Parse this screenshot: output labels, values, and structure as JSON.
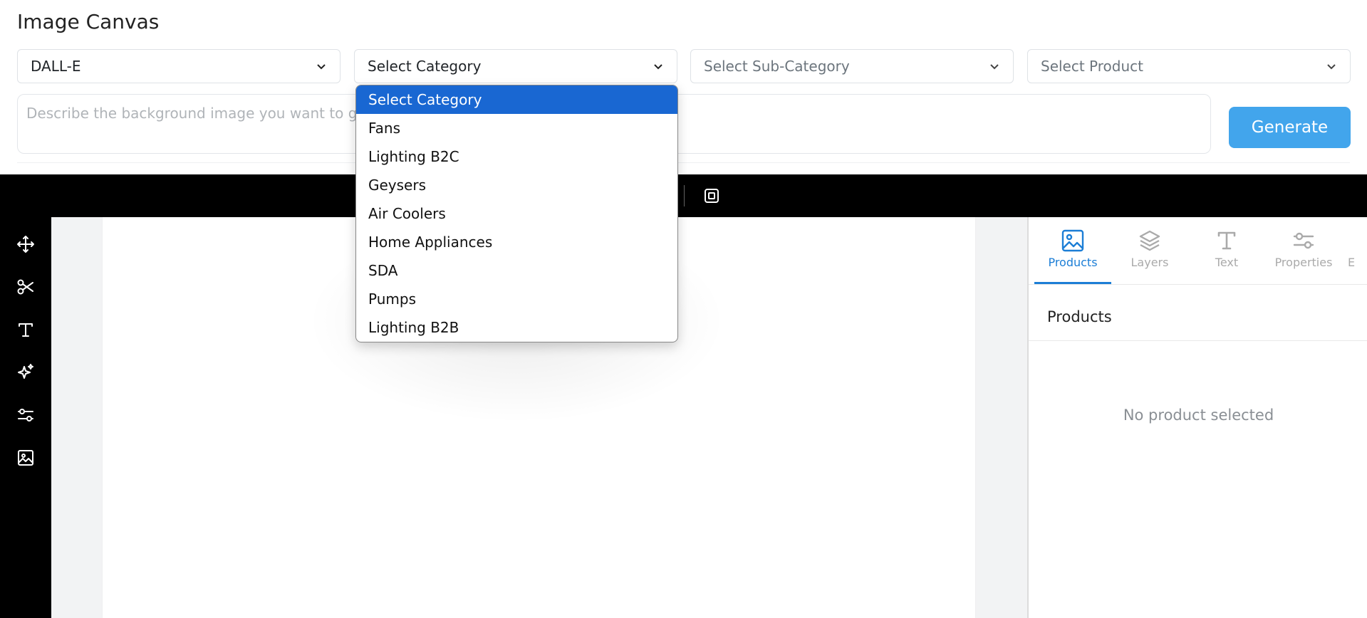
{
  "app": {
    "title": "Image Canvas"
  },
  "filters": {
    "model": "DALL-E",
    "category": "Select Category",
    "subcategory": "Select Sub-Category",
    "product": "Select Product"
  },
  "prompt": {
    "placeholder": "Describe the background image you want to gene"
  },
  "generate": {
    "label": "Generate"
  },
  "category_dropdown": {
    "options": [
      "Select Category",
      "Fans",
      "Lighting B2C",
      "Geysers",
      "Air Coolers",
      "Home Appliances",
      "SDA",
      "Pumps",
      "Lighting B2B"
    ],
    "selected": "Select Category"
  },
  "tools": [
    "move-icon",
    "scissors-icon",
    "text-icon",
    "sparkle-icon",
    "sliders-icon",
    "image-icon"
  ],
  "panel": {
    "tabs": [
      {
        "label": "Products",
        "icon": "image-icon",
        "active": true
      },
      {
        "label": "Layers",
        "icon": "layers-icon",
        "active": false
      },
      {
        "label": "Text",
        "icon": "text-icon",
        "active": false
      },
      {
        "label": "Properties",
        "icon": "sliders-icon",
        "active": false
      },
      {
        "label": "E",
        "icon": "",
        "active": false
      }
    ],
    "section_title": "Products",
    "empty_message": "No product selected"
  },
  "colors": {
    "accent": "#1c7ed6",
    "generate": "#42a5ec",
    "dropdown_highlight": "#1967d2"
  }
}
